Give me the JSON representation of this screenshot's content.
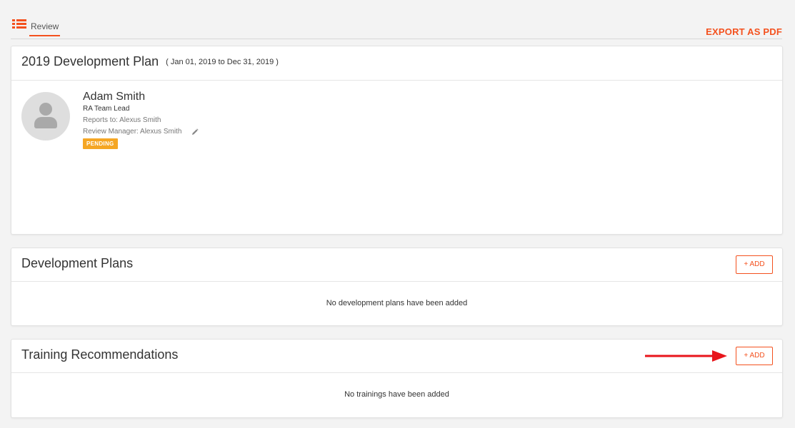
{
  "tabs": [
    {
      "label": "Review",
      "active": true
    }
  ],
  "export_label": "EXPORT AS PDF",
  "plan": {
    "title": "2019 Development Plan",
    "date_range": "( Jan 01, 2019 to Dec 31, 2019 )",
    "person": {
      "name": "Adam Smith",
      "role": "RA Team Lead",
      "reports_to": "Reports to: Alexus Smith",
      "review_manager": "Review Manager: Alexus Smith",
      "status": "PENDING"
    }
  },
  "development_plans": {
    "title": "Development Plans",
    "add_label": "+ ADD",
    "empty_message": "No development plans have been added"
  },
  "training": {
    "title": "Training Recommendations",
    "add_label": "+ ADD",
    "empty_message": "No trainings have been added"
  },
  "colors": {
    "accent": "#f4511e",
    "status_pending": "#f5a623",
    "annotation_arrow": "#e8151b"
  },
  "icons": {
    "tab": "list-icon",
    "edit": "pencil-icon",
    "avatar": "user-avatar-icon"
  }
}
